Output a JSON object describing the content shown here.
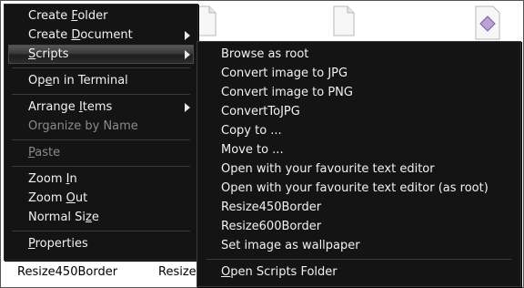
{
  "background": {
    "file_labels": [
      "Resize450Border",
      "Resize"
    ]
  },
  "main_menu": {
    "items": [
      {
        "label": "Create Folder",
        "mn": "F"
      },
      {
        "label": "Create Document",
        "mn": "D",
        "submenu": true
      },
      {
        "label": "Scripts",
        "mn": "S",
        "submenu": true,
        "highlighted": true
      },
      {
        "label": "Open in Terminal",
        "mn": "e"
      },
      {
        "label": "Arrange Items",
        "mn": "I",
        "submenu": true
      },
      {
        "label": "Organize by Name",
        "mn": "",
        "disabled": true
      },
      {
        "label": "Paste",
        "mn": "P",
        "disabled": true
      },
      {
        "label": "Zoom In",
        "mn": "I"
      },
      {
        "label": "Zoom Out",
        "mn": "O"
      },
      {
        "label": "Normal Size",
        "mn": "z"
      },
      {
        "label": "Properties",
        "mn": "P"
      }
    ]
  },
  "scripts_menu": {
    "items": [
      "Browse as root",
      "Convert image to JPG",
      "Convert image to PNG",
      "ConvertToJPG",
      "Copy to ...",
      "Move to ...",
      "Open with your favourite text editor",
      "Open with your favourite text editor (as root)",
      "Resize450Border",
      "Resize600Border",
      "Set image as wallpaper"
    ],
    "footer": {
      "label": "Open Scripts Folder",
      "mn": "O"
    }
  }
}
